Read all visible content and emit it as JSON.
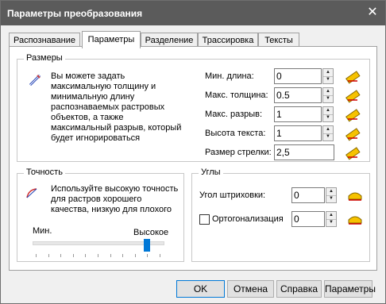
{
  "window": {
    "title": "Параметры преобразования",
    "close_glyph": "✕"
  },
  "tabs": [
    {
      "label": "Распознавание",
      "active": false
    },
    {
      "label": "Параметры",
      "active": true
    },
    {
      "label": "Разделение",
      "active": false
    },
    {
      "label": "Трассировка",
      "active": false
    },
    {
      "label": "Тексты",
      "active": false
    }
  ],
  "sizes": {
    "legend": "Размеры",
    "description": [
      "Вы можете задать",
      "максимальную толщину и",
      "минимальную длину",
      "распознаваемых растровых",
      "объектов, а также",
      "максимальный разрыв, который",
      "будет игнорироваться"
    ],
    "fields": {
      "min_length": {
        "label": "Мин. длина:",
        "value": "0"
      },
      "max_thickness": {
        "label": "Макс. толщина:",
        "value": "0.5"
      },
      "max_gap": {
        "label": "Макс. разрыв:",
        "value": "1"
      },
      "text_height": {
        "label": "Высота текста:",
        "value": "1"
      },
      "arrow_size": {
        "label": "Размер стрелки:",
        "value": "2,5"
      }
    }
  },
  "accuracy": {
    "legend": "Точность",
    "description": [
      "Используйте высокую точность",
      "для растров хорошего",
      "качества, низкую для плохого"
    ],
    "slider": {
      "min_label": "Мин.",
      "value_label": "Высокое",
      "level_fraction": 0.9
    }
  },
  "angles": {
    "legend": "Углы",
    "hatch": {
      "label": "Угол штриховки:",
      "value": "0"
    },
    "ortho": {
      "label": "Ортогонализация",
      "value": "0",
      "checked": false
    }
  },
  "buttons": {
    "ok": "OK",
    "cancel": "Отмена",
    "help": "Справка",
    "params": "Параметры"
  },
  "colors": {
    "accent": "#0078d7",
    "titlebar": "#5b5b5b",
    "pick_icon": "#d1a000"
  }
}
